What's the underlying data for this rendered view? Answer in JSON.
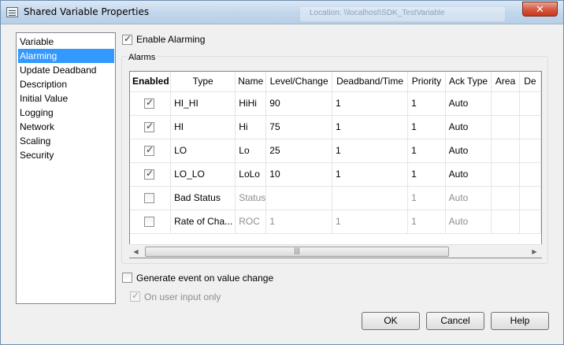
{
  "window": {
    "title": "Shared Variable Properties",
    "background_caption": "Location: \\\\localhost\\SDK_TestVariable",
    "close_glyph": "✕"
  },
  "categories": [
    {
      "label": "Variable",
      "selected": false
    },
    {
      "label": "Alarming",
      "selected": true
    },
    {
      "label": "Update Deadband",
      "selected": false
    },
    {
      "label": "Description",
      "selected": false
    },
    {
      "label": "Initial Value",
      "selected": false
    },
    {
      "label": "Logging",
      "selected": false
    },
    {
      "label": "Network",
      "selected": false
    },
    {
      "label": "Scaling",
      "selected": false
    },
    {
      "label": "Security",
      "selected": false
    }
  ],
  "enable_alarming": {
    "label": "Enable Alarming",
    "checked": true
  },
  "alarms_group": {
    "label": "Alarms"
  },
  "table": {
    "columns": [
      "Enabled",
      "Type",
      "Name",
      "Level/Change",
      "Deadband/Time",
      "Priority",
      "Ack Type",
      "Area",
      "De"
    ],
    "rows": [
      {
        "enabled": true,
        "type": "HI_HI",
        "name": "HiHi",
        "level": "90",
        "deadband": "1",
        "priority": "1",
        "ack": "Auto",
        "area": "",
        "desc": "",
        "dim": false
      },
      {
        "enabled": true,
        "type": "HI",
        "name": "Hi",
        "level": "75",
        "deadband": "1",
        "priority": "1",
        "ack": "Auto",
        "area": "",
        "desc": "",
        "dim": false
      },
      {
        "enabled": true,
        "type": "LO",
        "name": "Lo",
        "level": "25",
        "deadband": "1",
        "priority": "1",
        "ack": "Auto",
        "area": "",
        "desc": "",
        "dim": false
      },
      {
        "enabled": true,
        "type": "LO_LO",
        "name": "LoLo",
        "level": "10",
        "deadband": "1",
        "priority": "1",
        "ack": "Auto",
        "area": "",
        "desc": "",
        "dim": false
      },
      {
        "enabled": false,
        "type": "Bad Status",
        "name": "Status",
        "level": "",
        "deadband": "",
        "priority": "1",
        "ack": "Auto",
        "area": "",
        "desc": "",
        "dim": true
      },
      {
        "enabled": false,
        "type": "Rate of Cha...",
        "name": "ROC",
        "level": "1",
        "deadband": "1",
        "priority": "1",
        "ack": "Auto",
        "area": "",
        "desc": "",
        "dim": true
      }
    ]
  },
  "scrollbar": {
    "left_arrow": "◀",
    "right_arrow": "▶",
    "grip": "|||"
  },
  "generate_event": {
    "label": "Generate event on value change",
    "checked": false
  },
  "user_input_only": {
    "label": "On user input only",
    "checked": true,
    "disabled": true
  },
  "buttons": {
    "ok": "OK",
    "cancel": "Cancel",
    "help": "Help"
  }
}
